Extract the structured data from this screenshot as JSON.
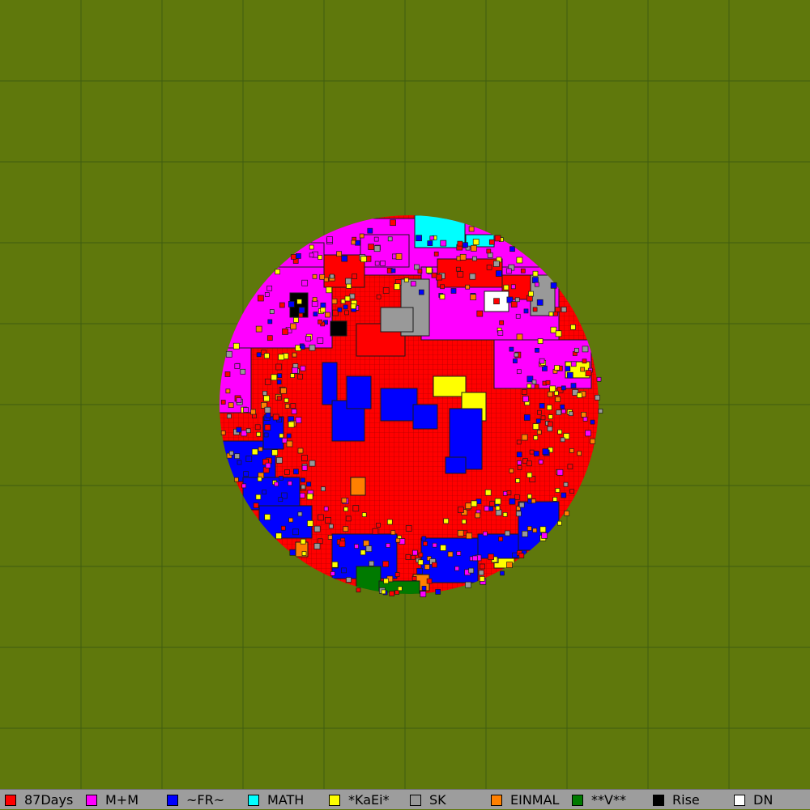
{
  "map": {
    "background_color": "#5f780c",
    "grid_color": "#3f5c10",
    "territory_border_color": "#1a1a1a"
  },
  "legend": {
    "teams": [
      {
        "name": "87Days",
        "color": "#ff0000"
      },
      {
        "name": "M+M",
        "color": "#ff00ff"
      },
      {
        "name": "~FR~",
        "color": "#0000ff"
      },
      {
        "name": "MATH",
        "color": "#00ffff"
      },
      {
        "name": "*KaEi*",
        "color": "#ffff00"
      },
      {
        "name": "SK",
        "color": "#999999"
      },
      {
        "name": "EINMAL",
        "color": "#ff8000"
      },
      {
        "name": "**V**",
        "color": "#007a00"
      },
      {
        "name": "Rise",
        "color": "#000000"
      },
      {
        "name": "DN",
        "color": "#ffffff"
      }
    ]
  }
}
